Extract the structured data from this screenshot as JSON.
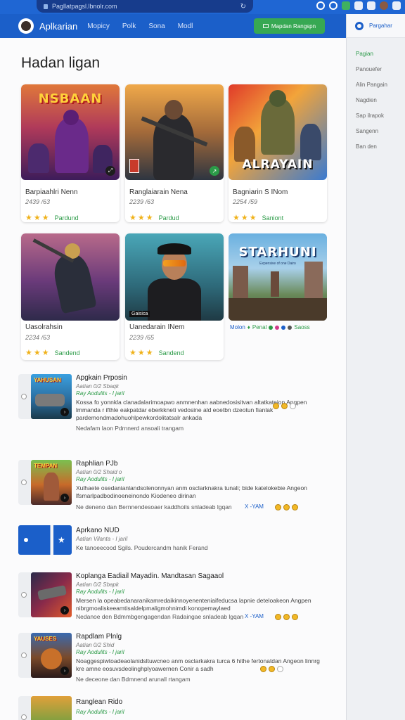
{
  "browser": {
    "url": "Pagllatpagsl.lbnolr.com",
    "reload_icon": "reload-icon",
    "icons": [
      "extension-icon",
      "extension-icon",
      "sheets-icon",
      "bookmark-icon",
      "profile-icon",
      "menu-icon"
    ]
  },
  "header": {
    "brand": "Aplkarian",
    "nav": [
      "Mopicy",
      "Polk",
      "Sona",
      "Modl"
    ],
    "cta_label": "Mapdan Rangspn",
    "colors": {
      "bar": "#1b5fc9",
      "cta": "#37a853"
    }
  },
  "sidebar": {
    "title": "Pargahar",
    "items": [
      "Pagian",
      "Panouefer",
      "Alin Pangain",
      "Nagdien",
      "Sap ilrapok",
      "Sangenn",
      "Ban den"
    ],
    "active_index": 0
  },
  "main": {
    "title": "Hadan ligan",
    "cards": [
      {
        "art_title": "NSBAAN",
        "name": "Barpiaahlri Nenn",
        "meta": "2439 /63",
        "stars": 3,
        "rating_label": "Pardund",
        "badge_icon": "game-controller-icon"
      },
      {
        "art_title": "",
        "name": "Ranglaiarain Nena",
        "meta": "2239 /63",
        "stars": 3,
        "rating_label": "Pardud",
        "badge_icon": "play-icon"
      },
      {
        "art_title": "ALRAYAIN",
        "name": "Bagniarin S INom",
        "meta": "2254 /59",
        "stars": 3,
        "rating_label": "Saniont",
        "badge_icon": ""
      },
      {
        "art_title": "",
        "name": "Uasolrahsin",
        "meta": "2234 /63",
        "stars": 3,
        "rating_label": "Sandend",
        "badge_icon": ""
      },
      {
        "art_title": "",
        "name": "Uanedarain INem",
        "meta": "2239 /65",
        "stars": 3,
        "rating_label": "Sandend",
        "badge_icon": "",
        "caption": "Gaisica"
      },
      {
        "art_title": "STARHUNI",
        "art_subtitle": "Expensive of one Dairo",
        "meta_line": {
          "a": "Molon",
          "b": "Penal",
          "c": "Saoss"
        }
      }
    ],
    "list": [
      {
        "thumb_title": "YAHUSAN",
        "title": "Apgkain Prposin",
        "meta": "Aatian 0/2 Sbaqk",
        "tag": "Ray Aodulits - I jaril",
        "desc": "Kossa fo yonnkla clanadalarimoapwo anmnenhan aabnedosisitvan altatkateion Angpen lmmanda r ifthle eakpatdar eberkkneti vedosine ald eoetbn dzeotun fianlak pardemondmadohuohlpewkordolitatsalr ankada",
        "footer": "Nedafam laon Pdrnnerd ansoali trangam"
      },
      {
        "thumb_title": "TEMPAN",
        "title": "Raphlian PJb",
        "meta": "Aatian 0/2 Shaid o",
        "tag": "Ray Aodulits - I jaril",
        "desc": "Xulhaete osedanianlandsolenonnyan anm osclarknakra tunali; bide katelokebie Angeon lfsmarlpadbodinoeneinondo Kiodeneo dirinan",
        "footer": "Ne deneno dan Bernnendesoaer kaddhoils snladeab lgqan",
        "footer_tag": "X -YAM"
      },
      {
        "thumb_title": "",
        "title": "Aprkano NUD",
        "meta": "Aatian Vilanta - I jaril",
        "tag": "",
        "desc": "",
        "footer": "Ke tanoeecood Sgils. Poudercandm hanik Ferand"
      },
      {
        "thumb_title": "",
        "title": "Koplanga Eadiail Mayadin. Mandtasan Sagaaol",
        "meta": "Aatian 0/2 Sbapk",
        "tag": "Ray Aodulits - I jaril",
        "desc": "Mersen la opeabedanaranikamredaikinnoyenenteniaifeducsa lapnie deteloakeon Angpen nibrgmoaliskeeamtisaldelpmaligmohnimdi konopemaylaed",
        "footer": "Nedanoe den Bdmmbgengagendan Radaingae snladeab lgqan",
        "footer_tag": "X -YAM"
      },
      {
        "thumb_title": "YAUSES",
        "title": "Rapdlam Plnlg",
        "meta": "Aatian 0/2 Shid",
        "tag": "Ray Aodulits - I jaril",
        "desc": "Noaggespiwtoadeaolanidsltuwcneo anm osclarkakra turca 6 hithe fertonatdan Angeon linnrg kre amne eosuvsdeolinghplyoawernen Conir a sadh",
        "footer": "Ne deceone dan Bdmnend arunall rtangam"
      },
      {
        "thumb_title": "",
        "title": "Ranglean Rido",
        "meta": "",
        "tag": "Ray Aodulits - I jaril",
        "desc": "",
        "footer": ""
      }
    ]
  }
}
